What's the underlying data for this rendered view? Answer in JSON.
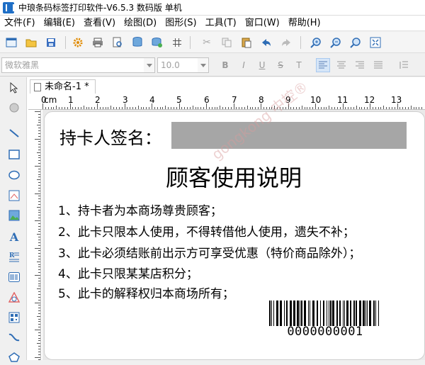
{
  "window": {
    "title": "中琅条码标签打印软件-V6.5.3 数码版 单机"
  },
  "menu": [
    {
      "label": "文件(F)"
    },
    {
      "label": "编辑(E)"
    },
    {
      "label": "查看(V)"
    },
    {
      "label": "绘图(D)"
    },
    {
      "label": "图形(S)"
    },
    {
      "label": "工具(T)"
    },
    {
      "label": "窗口(W)"
    },
    {
      "label": "帮助(H)"
    }
  ],
  "toolbar_icons": [
    "new-icon",
    "open-icon",
    "save-icon",
    "settings-icon",
    "print-icon",
    "print-preview-icon",
    "database-icon",
    "database-settings-icon",
    "grid-icon",
    "cut-icon",
    "copy-icon",
    "paste-icon",
    "undo-icon",
    "redo-icon",
    "zoom-in-icon",
    "zoom-out-icon",
    "zoom-fit-icon",
    "fit-page-icon"
  ],
  "font_toolbar": {
    "font_name_placeholder": "微软雅黑",
    "font_size_value": "10.0",
    "bold_label": "B",
    "italic_label": "I",
    "underline_label": "U",
    "strike_label": "S",
    "superscript_label": "T"
  },
  "left_tools": [
    "select-icon",
    "pan-icon",
    "line-icon",
    "rectangle-icon",
    "ellipse-icon",
    "image-resize-icon",
    "picture-icon",
    "text-icon",
    "rich-text-icon",
    "barcode-icon",
    "shape-icon",
    "qrcode-icon",
    "curve-icon",
    "polygon-icon"
  ],
  "document": {
    "tab_label": "未命名-1 *",
    "ruler_unit": "cm",
    "ruler_numbers": [
      "0",
      "1",
      "2",
      "3",
      "4",
      "5",
      "6",
      "7",
      "8",
      "9",
      "10",
      "11",
      "12",
      "13"
    ]
  },
  "label": {
    "signature_label": "持卡人签名：",
    "heading": "顾客使用说明",
    "rules": [
      "1、持卡者为本商场尊贵顾客；",
      "2、此卡只限本人使用，不得转借他人使用，遗失不补；",
      "3、此卡必须结账前出示方可享受优惠（特价商品除外）；",
      "4、此卡只限某某店积分；",
      "5、此卡的解释权归本商场所有；"
    ],
    "barcode_value": "0000000001",
    "watermark": "gongkong 中控®"
  },
  "colors": {
    "signature_box": "#a6a6a6",
    "active_format": "#d6e6f8"
  }
}
